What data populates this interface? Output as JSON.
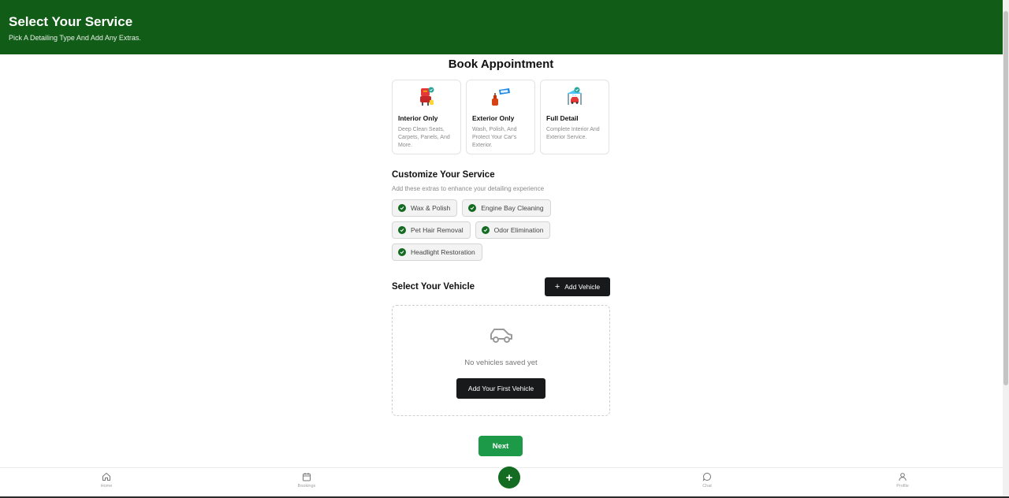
{
  "header": {
    "title": "Select Your Service",
    "subtitle": "Pick A Detailing Type And Add Any Extras."
  },
  "page_title": "Book Appointment",
  "services": [
    {
      "name": "Interior Only",
      "desc": "Deep Clean Seats, Carpets, Panels, And More.",
      "icon": "car-seat-icon"
    },
    {
      "name": "Exterior Only",
      "desc": "Wash, Polish, And Protect Your Car's Exterior.",
      "icon": "spray-car-icon"
    },
    {
      "name": "Full Detail",
      "desc": "Complete Interior And Exterior Service.",
      "icon": "car-wash-icon"
    }
  ],
  "customize": {
    "title": "Customize Your Service",
    "subtitle": "Add these extras to enhance your detailing experience",
    "extras": [
      "Wax & Polish",
      "Engine Bay Cleaning",
      "Pet Hair Removal",
      "Odor Elimination",
      "Headlight Restoration"
    ]
  },
  "vehicle": {
    "title": "Select Your Vehicle",
    "add_label": "Add Vehicle",
    "empty_text": "No vehicles saved yet",
    "first_label": "Add Your First Vehicle"
  },
  "next_label": "Next",
  "nav": {
    "home": "Home",
    "bookings": "Bookings",
    "fab": "+",
    "chat": "Chat",
    "profile": "Profile"
  },
  "colors": {
    "header_green": "#115c17",
    "next_green": "#1d9a47",
    "check_green": "#146b22",
    "dark_button": "#18191b"
  }
}
